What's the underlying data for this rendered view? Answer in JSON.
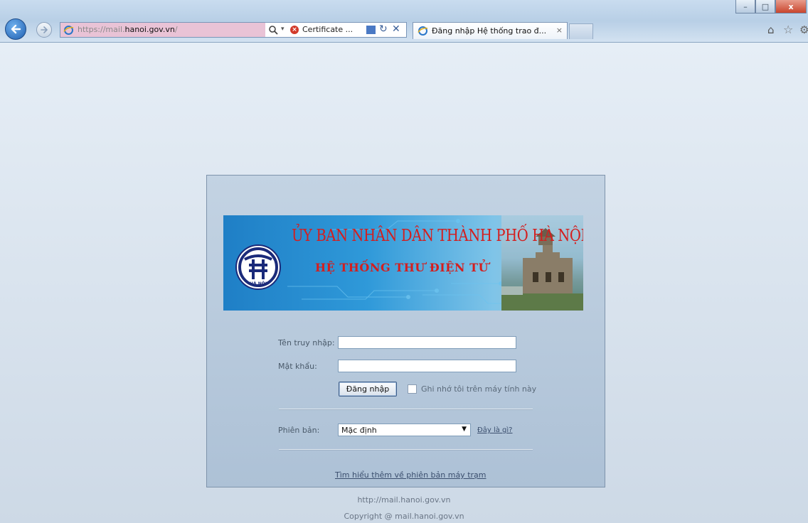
{
  "browser": {
    "url_prefix": "https://mail.",
    "url_domain": "hanoi.gov.vn",
    "url_suffix": "/",
    "certificate_label": "Certificate ...",
    "tab_title": "Đăng nhập Hệ thống trao đ...",
    "tab_close": "×",
    "window_buttons": {
      "minimize": "–",
      "maximize": "□",
      "close": "x"
    }
  },
  "banner": {
    "title": "ỦY BAN NHÂN DÂN THÀNH PHỐ HÀ NỘI",
    "subtitle": "HỆ THỐNG THƯ ĐIỆN TỬ",
    "logo_text": "HÀ NỘI"
  },
  "form": {
    "username_label": "Tên truy nhập:",
    "username_value": "",
    "password_label": "Mật khẩu:",
    "password_value": "",
    "login_button": "Đăng nhập",
    "remember_label": "Ghi nhớ tôi trên máy tính này",
    "remember_checked": false,
    "version_label": "Phiên bản:",
    "version_selected": "Mặc định",
    "whats_this_link": "Đây là gì?",
    "learn_more_link": "Tìm hiểu thêm về phiên bản máy trạm"
  },
  "footer": {
    "url": "http://mail.hanoi.gov.vn",
    "copyright": "Copyright @ mail.hanoi.gov.vn"
  },
  "colors": {
    "banner_text": "#d41e1e",
    "login_panel": "#b7c9dc",
    "page_background": "#cdd9e6"
  }
}
